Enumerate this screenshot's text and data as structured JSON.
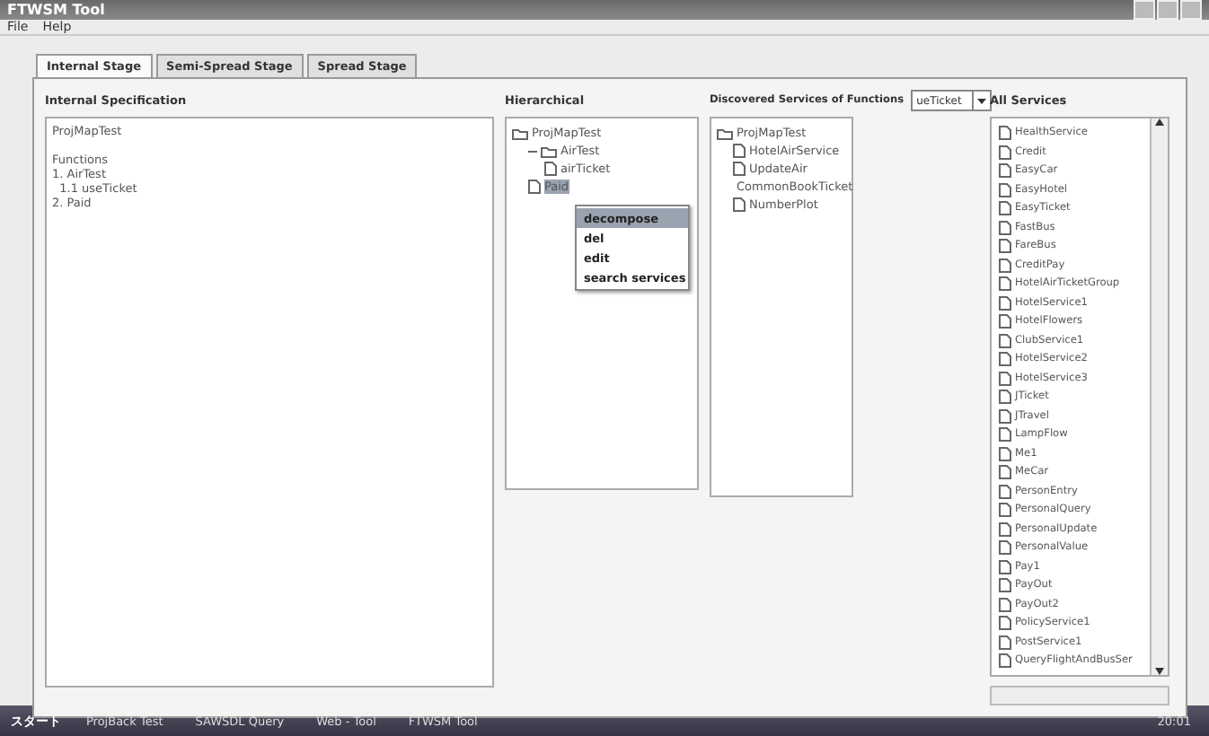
{
  "window": {
    "title": "FTWSM Tool"
  },
  "menu": [
    "File",
    "Help"
  ],
  "tabs": [
    {
      "label": "Internal Stage",
      "selected": true
    },
    {
      "label": "Semi-Spread Stage",
      "selected": false
    },
    {
      "label": "Spread Stage",
      "selected": false
    }
  ],
  "internal_specification": {
    "title": "Internal Specification",
    "project": "ProjMapTest",
    "lines": [
      "Functions",
      "1. AirTest",
      "  1.1 useTicket",
      "2. Paid"
    ]
  },
  "hierarchical": {
    "title": "Hierarchical",
    "tree": [
      {
        "label": "ProjMapTest",
        "selected": false,
        "children": [
          {
            "label": "AirTest",
            "expanded": true,
            "selected": false,
            "children": [
              {
                "label": "airTicket",
                "selected": false
              }
            ]
          },
          {
            "label": "Paid",
            "selected": true
          }
        ]
      }
    ]
  },
  "context_menu": [
    {
      "label": "decompose",
      "selected": true
    },
    {
      "label": "del",
      "selected": false
    },
    {
      "label": "edit",
      "selected": false
    },
    {
      "label": "search services",
      "selected": false
    }
  ],
  "discovered": {
    "title": "Discovered Services of Functions",
    "combo": "ueTicket",
    "tree": [
      {
        "label": "ProjMapTest",
        "children": [
          {
            "label": "HotelAirService"
          },
          {
            "label": "UpdateAir"
          },
          {
            "label": "CommonBookTicket"
          },
          {
            "label": "NumberPlot"
          }
        ]
      }
    ]
  },
  "all_services": {
    "title": "All Services",
    "items": [
      "HealthService",
      "Credit",
      "EasyCar",
      "EasyHotel",
      "EasyTicket",
      "FastBus",
      "FareBus",
      "CreditPay",
      "HotelAirTicketGroup",
      "HotelService1",
      "HotelFlowers",
      "ClubService1",
      "HotelService2",
      "HotelService3",
      "JTicket",
      "JTravel",
      "LampFlow",
      "Me1",
      "MeCar",
      "PersonEntry",
      "PersonalQuery",
      "PersonalUpdate",
      "PersonalValue",
      "Pay1",
      "PayOut",
      "PayOut2",
      "PolicyService1",
      "PostService1",
      "QueryFlightAndBusSer"
    ]
  },
  "taskbar": {
    "start": "スタート",
    "tasks": [
      "ProjBack Test",
      "SAWSDL Query",
      "Web - Tool",
      "FTWSM Tool"
    ],
    "tray": "20:01"
  }
}
